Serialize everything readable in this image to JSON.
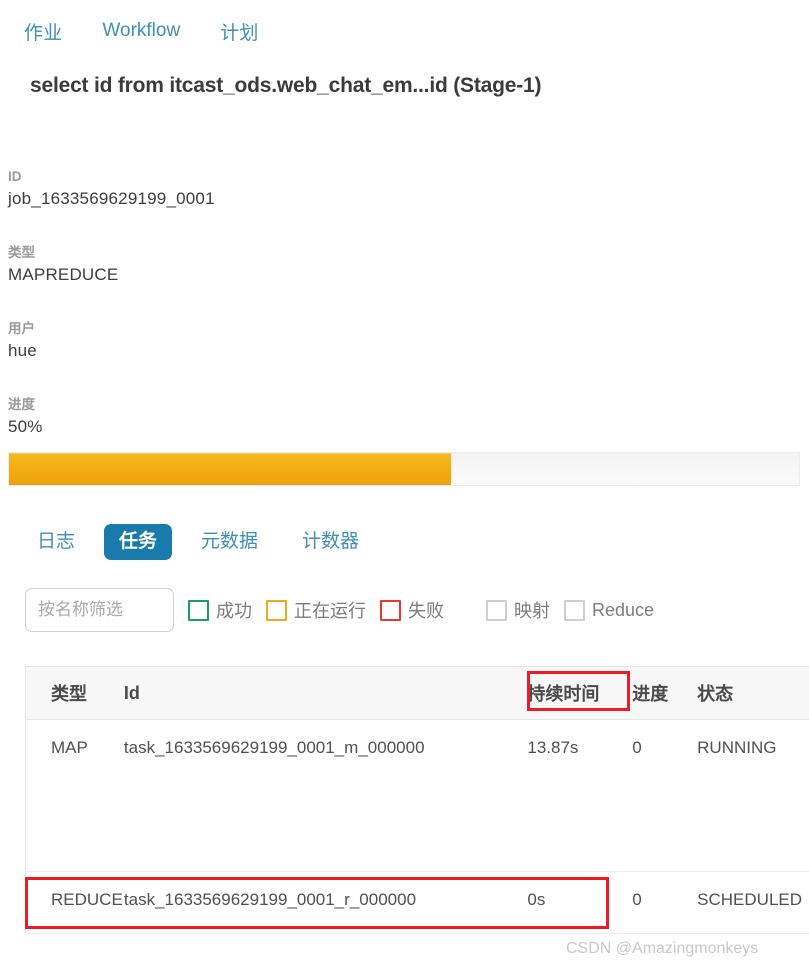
{
  "topnav": {
    "items": [
      {
        "label": "作业",
        "name": "nav-jobs"
      },
      {
        "label": "Workflow",
        "name": "nav-workflow"
      },
      {
        "label": "计划",
        "name": "nav-schedule"
      }
    ]
  },
  "page": {
    "title": "select id from itcast_ods.web_chat_em...id (Stage-1)"
  },
  "details": {
    "id_label": "ID",
    "id_value": "job_1633569629199_0001",
    "type_label": "类型",
    "type_value": "MAPREDUCE",
    "user_label": "用户",
    "user_value": "hue",
    "progress_label": "进度",
    "progress_value": "50%",
    "progress_percent": 56
  },
  "tabs": [
    {
      "label": "日志",
      "active": false
    },
    {
      "label": "任务",
      "active": true
    },
    {
      "label": "元数据",
      "active": false
    },
    {
      "label": "计数器",
      "active": false
    }
  ],
  "filters": {
    "search_placeholder": "按名称筛选",
    "search_value": "",
    "checkboxes": [
      {
        "label": "成功",
        "color": "#1aa05a",
        "checked": false
      },
      {
        "label": "正在运行",
        "color": "#f0a81e",
        "checked": false
      },
      {
        "label": "失败",
        "color": "#e8392f",
        "checked": false
      },
      {
        "label": "映射",
        "color": "#cfcfcf",
        "checked": false
      },
      {
        "label": "Reduce",
        "color": "#cfcfcf",
        "checked": false
      }
    ]
  },
  "table": {
    "columns": [
      "类型",
      "Id",
      "持续时间",
      "进度",
      "状态"
    ],
    "rows": [
      {
        "type": "MAP",
        "id": "task_1633569629199_0001_m_000000",
        "duration": "13.87s",
        "progress": "0",
        "status": "RUNNING"
      },
      {
        "type": "REDUCE",
        "id": "task_1633569629199_0001_r_000000",
        "duration": "0s",
        "progress": "0",
        "status": "SCHEDULED"
      }
    ]
  },
  "annotations": {
    "accent_color": "#ec1c24",
    "duration_header_highlight": "持续时间",
    "reduce_row_highlight": "REDUCE"
  },
  "watermark": {
    "text": "CSDN @Amazingmonkeys"
  }
}
